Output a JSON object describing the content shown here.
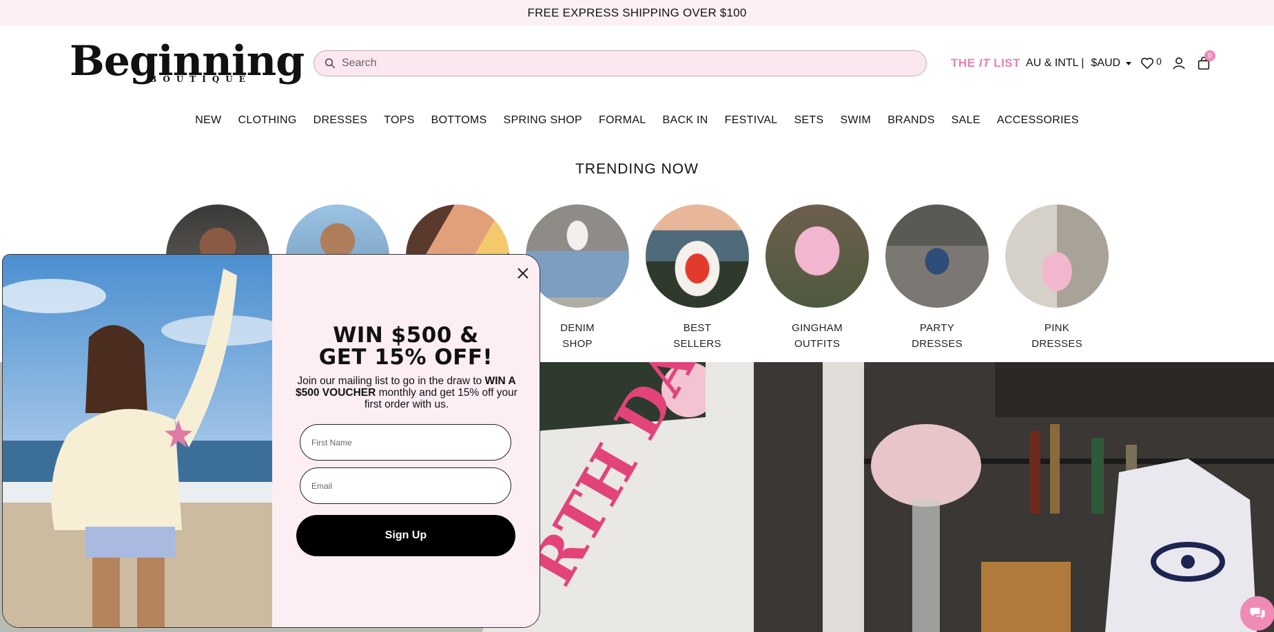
{
  "announcement": "FREE EXPRESS SHIPPING OVER $100",
  "logo": {
    "word": "Beginning",
    "sub": "BOUTIQUE"
  },
  "search": {
    "placeholder": "Search"
  },
  "utilities": {
    "it_list_prefix": "THE ",
    "it_list_italic": "IT",
    "it_list_suffix": " LIST",
    "region": "AU & INTL |",
    "currency": "$AUD",
    "wishlist_count": "0",
    "cart_count": "0"
  },
  "nav": [
    "NEW",
    "CLOTHING",
    "DRESSES",
    "TOPS",
    "BOTTOMS",
    "SPRING SHOP",
    "FORMAL",
    "BACK IN",
    "FESTIVAL",
    "SETS",
    "SWIM",
    "BRANDS",
    "SALE",
    "ACCESSORIES"
  ],
  "trending_title": "TRENDING NOW",
  "trending": [
    {
      "line1": "",
      "line2": ""
    },
    {
      "line1": "",
      "line2": ""
    },
    {
      "line1": "",
      "line2": ""
    },
    {
      "line1": "DENIM",
      "line2": "SHOP"
    },
    {
      "line1": "BEST",
      "line2": "SELLERS"
    },
    {
      "line1": "GINGHAM",
      "line2": "OUTFITS"
    },
    {
      "line1": "PARTY",
      "line2": "DRESSES"
    },
    {
      "line1": "PINK",
      "line2": "DRESSES"
    }
  ],
  "popup": {
    "headline_1": "WIN $500 &",
    "headline_2": "GET 15% OFF!",
    "blurb_1": "Join our mailing list to go in the draw to",
    "blurb_bold": "WIN A $500 VOUCHER",
    "blurb_2": " monthly and get 15% off your first order with us.",
    "first_name_placeholder": "First Name",
    "email_placeholder": "Email",
    "signup_label": "Sign Up"
  },
  "colors": {
    "accent_pink": "#ef7fae",
    "banner_bg": "#fdf0f5",
    "popup_bg": "#fdeef4"
  }
}
